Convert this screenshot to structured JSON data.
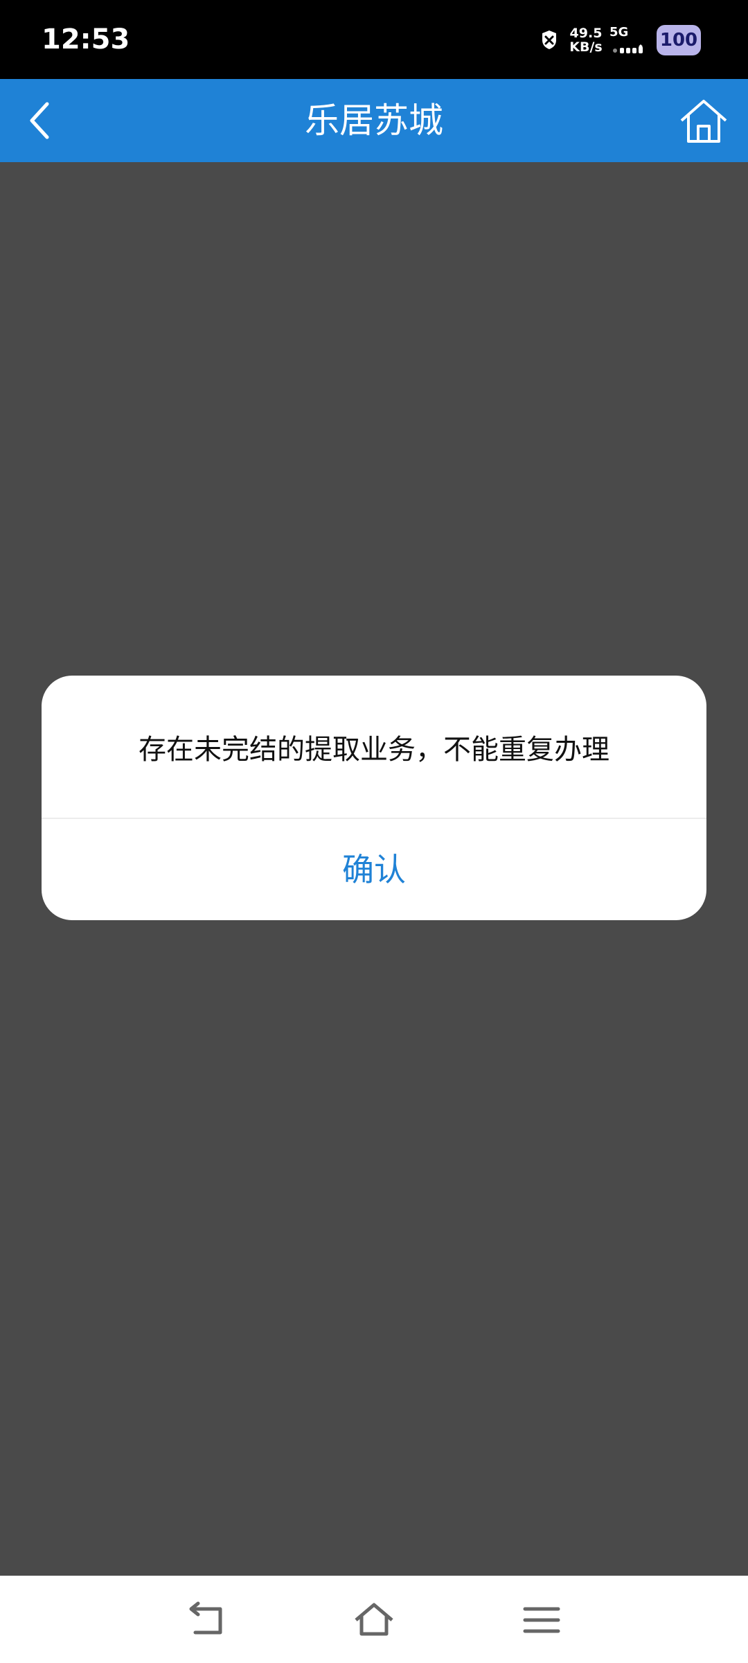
{
  "status_bar": {
    "time": "12:53",
    "net_speed_value": "49.5",
    "net_speed_unit": "KB/s",
    "network_type": "5G",
    "battery_level": "100"
  },
  "header": {
    "title": "乐居苏城",
    "back_icon": "chevron-left-icon",
    "home_icon": "home-icon",
    "background_color": "#1f82d6"
  },
  "dialog": {
    "message": "存在未完结的提取业务，不能重复办理",
    "confirm_label": "确认",
    "confirm_color": "#1f82d6"
  },
  "nav_bar": {
    "back_icon": "nav-back-icon",
    "home_icon": "nav-home-icon",
    "menu_icon": "nav-menu-icon"
  }
}
